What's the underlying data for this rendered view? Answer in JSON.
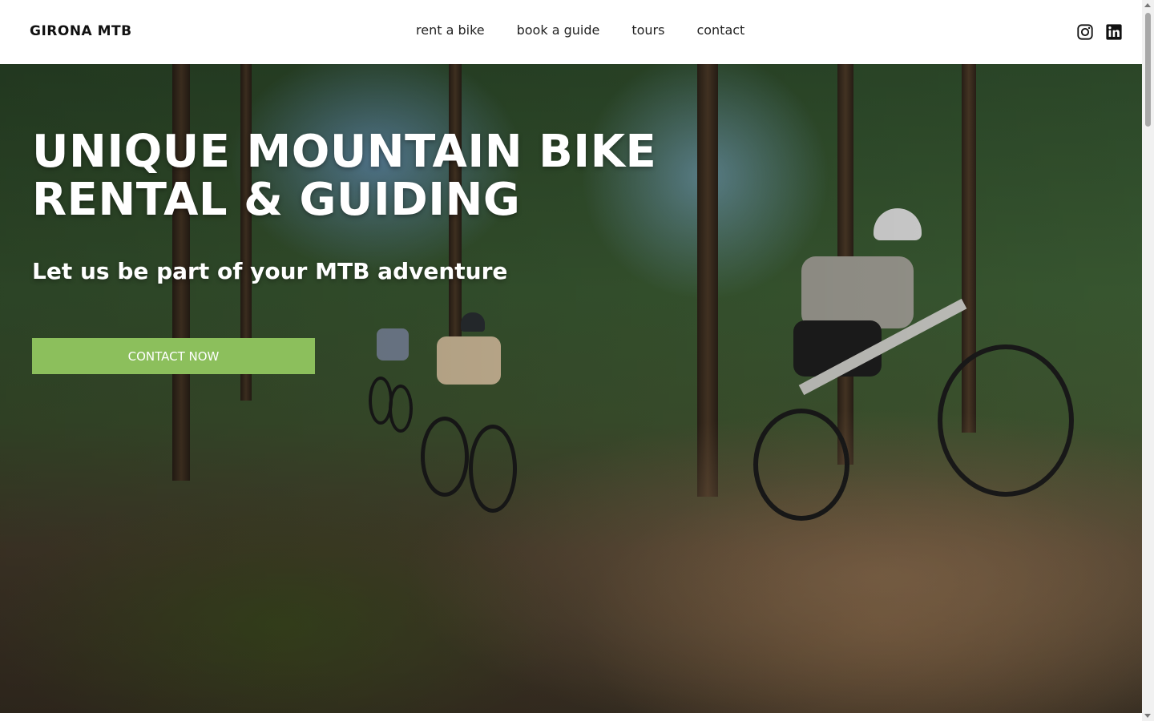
{
  "header": {
    "logo": "GIRONA MTB",
    "nav": [
      "rent a bike",
      "book a guide",
      "tours",
      "contact"
    ],
    "social": [
      "instagram-icon",
      "linkedin-icon"
    ]
  },
  "hero": {
    "title_line1": "UNIQUE MOUNTAIN BIKE",
    "title_line2": "RENTAL & GUIDING",
    "subtitle": "Let us be part of your MTB adventure",
    "cta_label": "CONTACT NOW",
    "cta_color": "#8cbf5c"
  }
}
